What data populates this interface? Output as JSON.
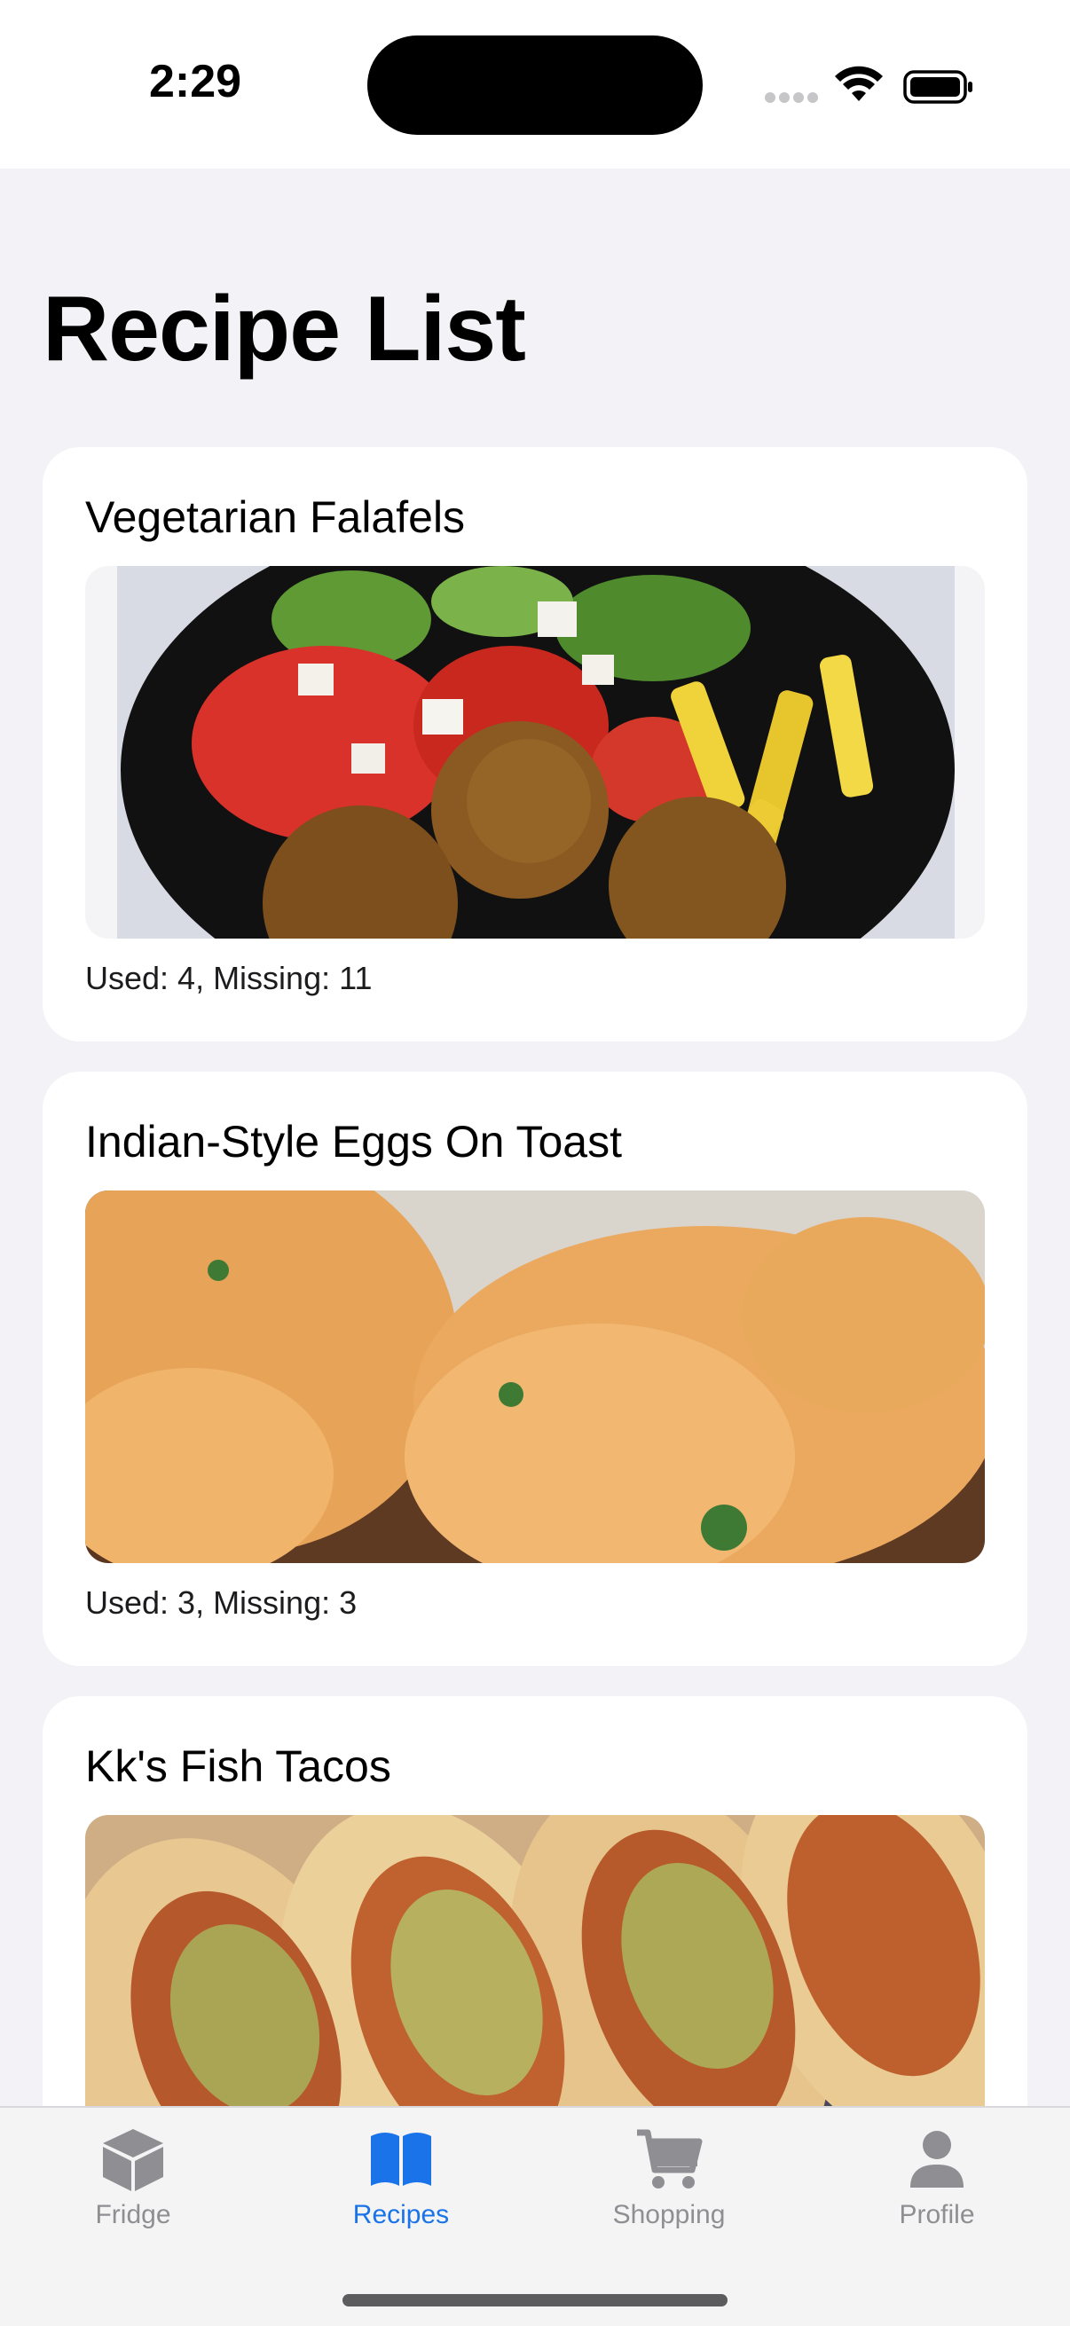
{
  "status_bar": {
    "time": "2:29"
  },
  "page": {
    "title": "Recipe List"
  },
  "recipes": [
    {
      "title": "Vegetarian Falafels",
      "meta": "Used: 4, Missing: 11",
      "image": "falafel-plate-photo"
    },
    {
      "title": "Indian-Style Eggs On Toast",
      "meta": "Used: 3, Missing: 3",
      "image": "eggs-on-toast-photo"
    },
    {
      "title": "Kk's Fish Tacos",
      "meta": "",
      "image": "fish-tacos-photo"
    }
  ],
  "tab_bar": {
    "active_color": "#1a73e8",
    "inactive_color": "#8e8e93",
    "tabs": [
      {
        "label": "Fridge",
        "icon": "box-icon"
      },
      {
        "label": "Recipes",
        "icon": "book-icon"
      },
      {
        "label": "Shopping",
        "icon": "cart-icon"
      },
      {
        "label": "Profile",
        "icon": "person-icon"
      }
    ],
    "active_tab": "Recipes"
  }
}
